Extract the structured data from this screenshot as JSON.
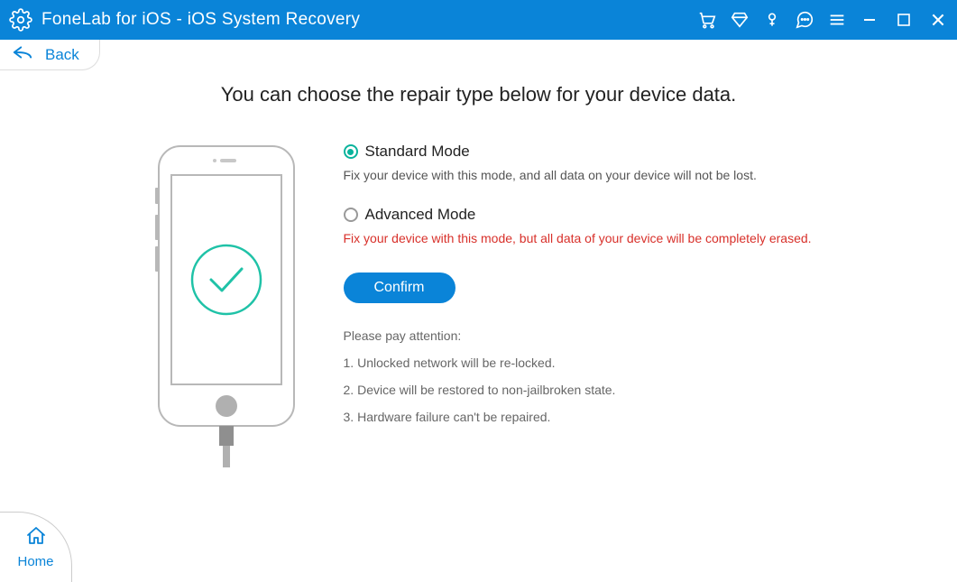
{
  "titlebar": {
    "title": "FoneLab for iOS - iOS System Recovery"
  },
  "nav": {
    "back_label": "Back",
    "home_label": "Home"
  },
  "main": {
    "heading": "You can choose the repair type below for your device data.",
    "modes": {
      "standard": {
        "label": "Standard Mode",
        "desc": "Fix your device with this mode, and all data on your device will not be lost.",
        "selected": true
      },
      "advanced": {
        "label": "Advanced Mode",
        "desc": "Fix your device with this mode, but all data of your device will be completely erased.",
        "selected": false
      }
    },
    "confirm_label": "Confirm",
    "attention": {
      "title": "Please pay attention:",
      "items": [
        "Unlocked network will be re-locked.",
        "Device will be restored to non-jailbroken state.",
        "Hardware failure can't be repaired."
      ]
    }
  }
}
